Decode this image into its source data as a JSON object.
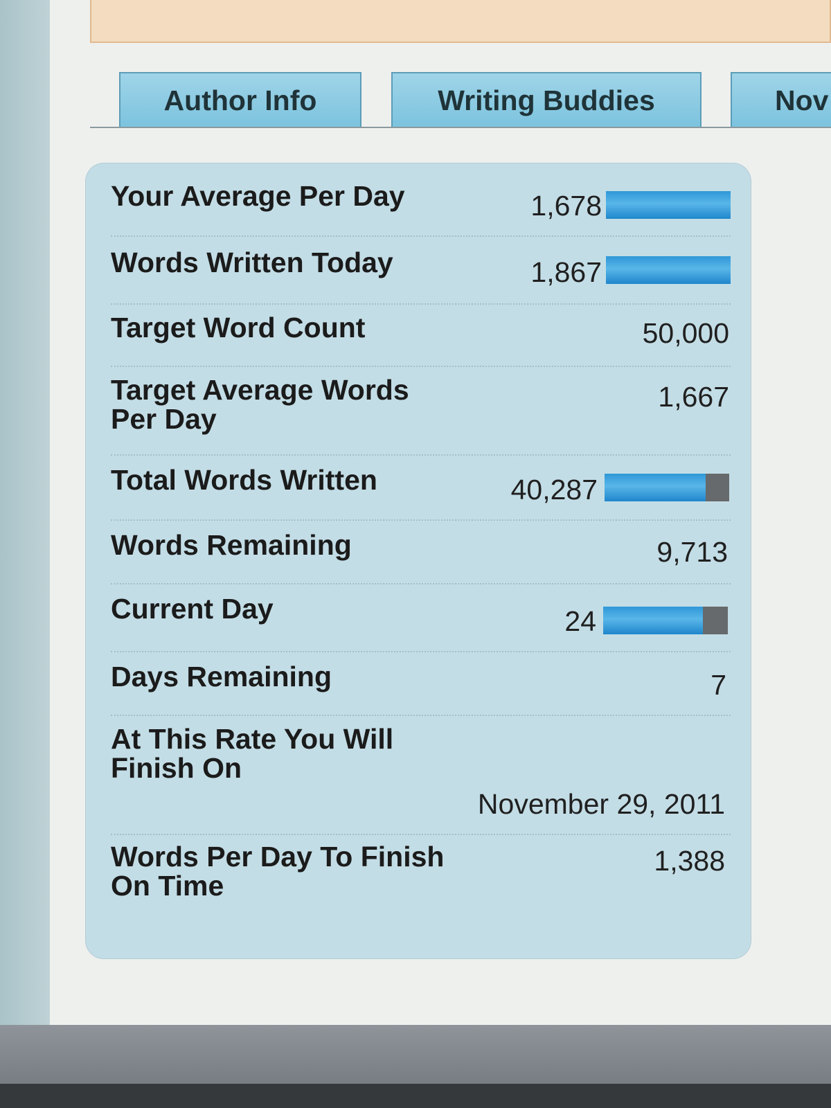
{
  "tabs": [
    {
      "label": "Author Info"
    },
    {
      "label": "Writing Buddies"
    },
    {
      "label": "Nov"
    }
  ],
  "stats": {
    "average_per_day": {
      "label": "Your Average Per Day",
      "value": "1,678",
      "bar_fill_fraction": 1.0
    },
    "words_today": {
      "label": "Words Written Today",
      "value": "1,867",
      "bar_fill_fraction": 1.0
    },
    "target_word_count": {
      "label": "Target Word Count",
      "value": "50,000"
    },
    "target_average": {
      "label": "Target Average Words Per Day",
      "value": "1,667"
    },
    "total_words": {
      "label": "Total Words Written",
      "value": "40,287",
      "bar_fill_fraction": 0.81
    },
    "words_remaining": {
      "label": "Words Remaining",
      "value": "9,713"
    },
    "current_day": {
      "label": "Current Day",
      "value": "24",
      "bar_fill_fraction": 0.8
    },
    "days_remaining": {
      "label": "Days Remaining",
      "value": "7"
    },
    "finish_date": {
      "label": "At This Rate You Will Finish On",
      "value": "November 29, 2011"
    },
    "words_to_finish": {
      "label": "Words Per Day To Finish On Time",
      "value": "1,388"
    }
  },
  "colors": {
    "bar_fill": "#2f98d8",
    "bar_remaining": "#666a6c",
    "panel_background": "#c3dde6",
    "tab_background": "#8ccbe3"
  }
}
